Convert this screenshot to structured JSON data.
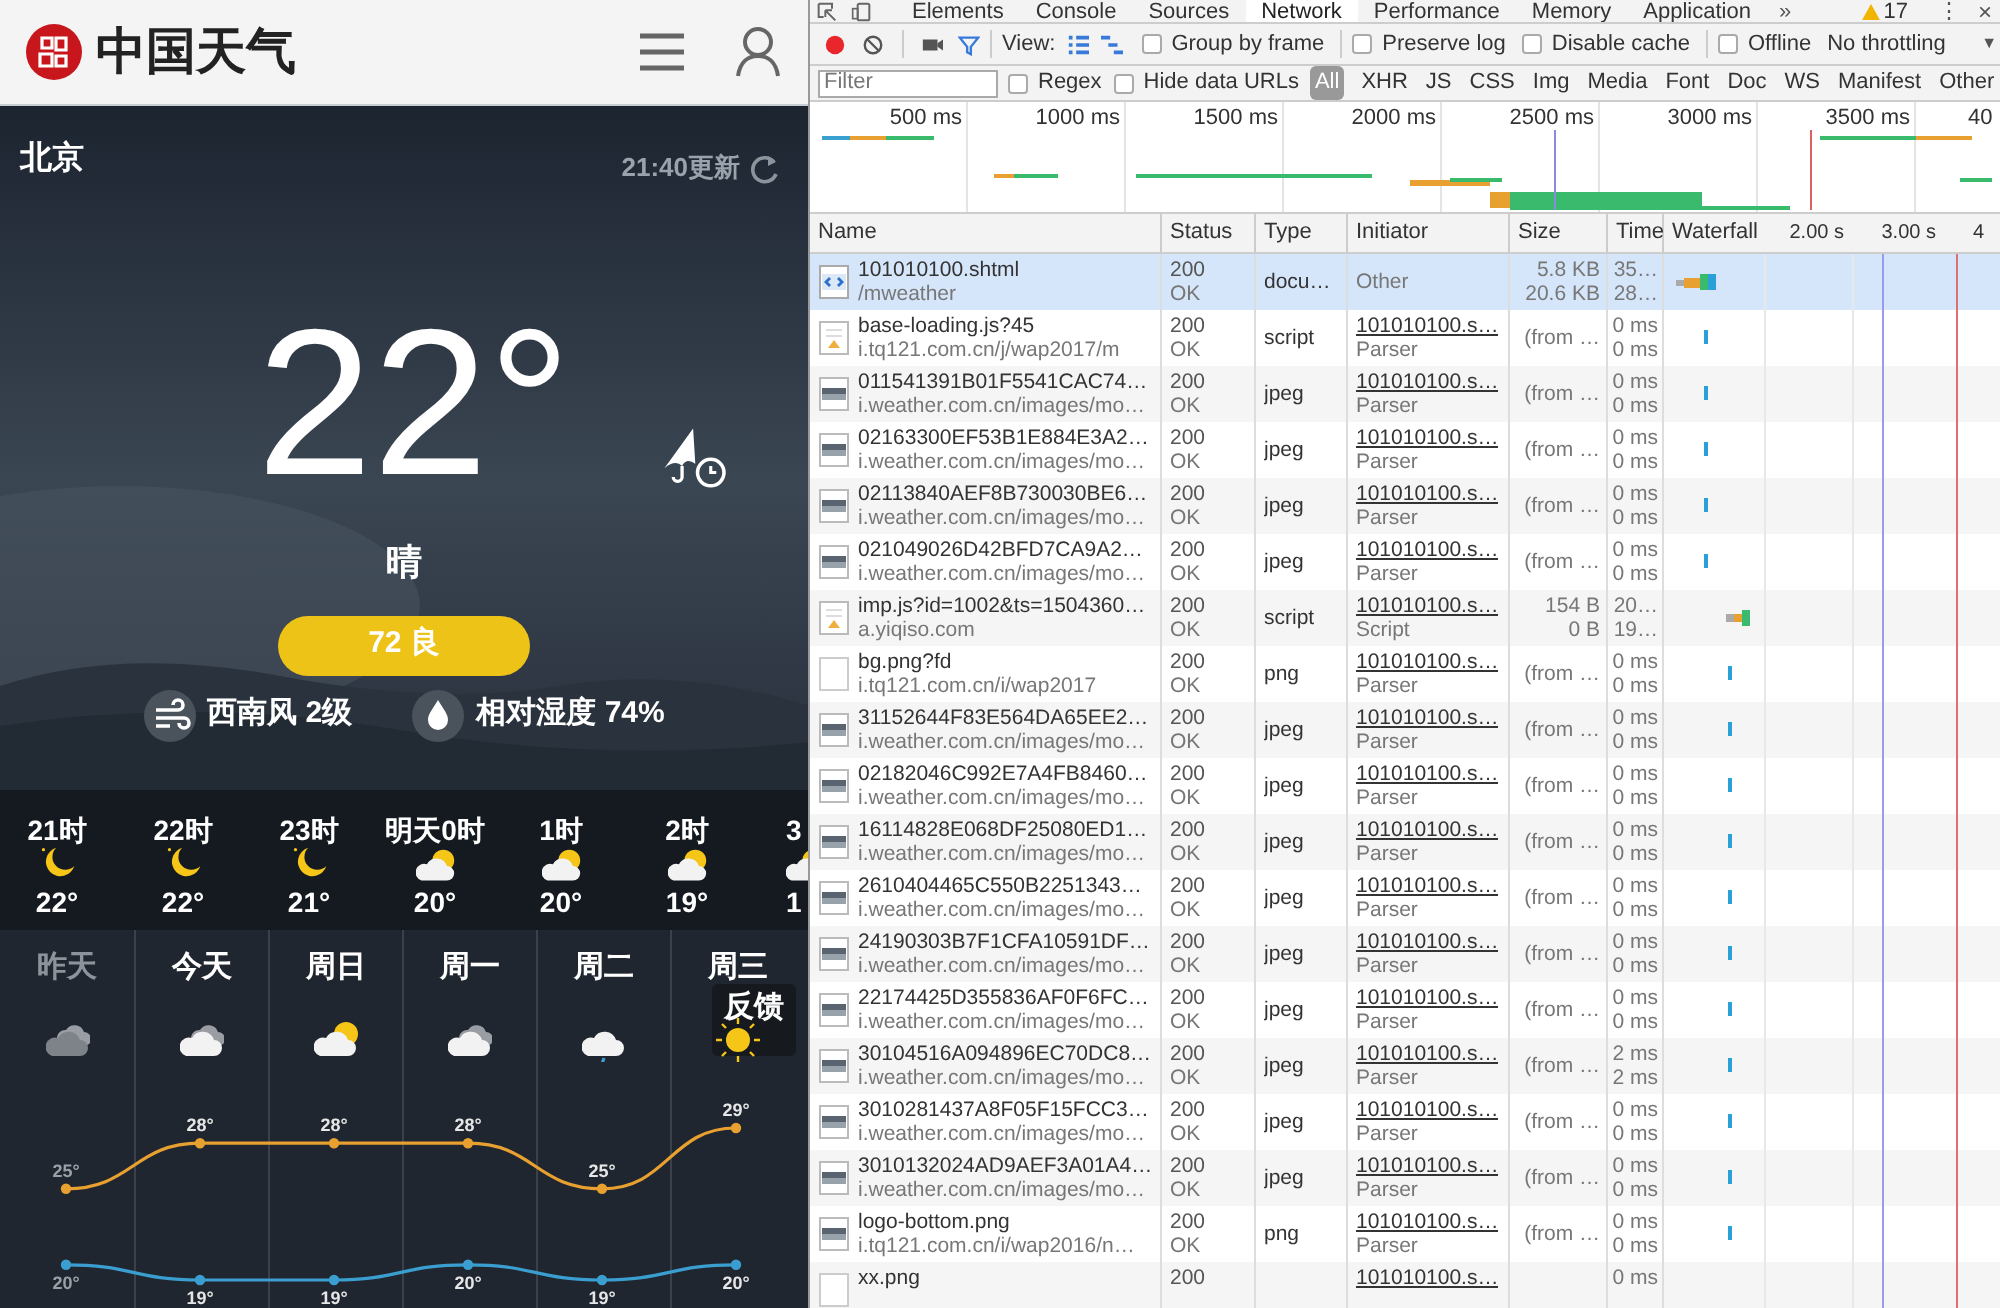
{
  "site": {
    "title": "中国天气"
  },
  "current": {
    "city": "北京",
    "updated": "21:40更新",
    "temperature": "22°",
    "condition": "晴",
    "aqi": "72 良",
    "wind": "西南风 2级",
    "humidity": "相对湿度 74%"
  },
  "hourly": [
    {
      "time": "21时",
      "kind": "moon",
      "temp": "22°"
    },
    {
      "time": "22时",
      "kind": "moon",
      "temp": "22°"
    },
    {
      "time": "23时",
      "kind": "moon",
      "temp": "21°"
    },
    {
      "time": "明天0时",
      "kind": "cloud-moon",
      "temp": "20°"
    },
    {
      "time": "1时",
      "kind": "cloud-moon",
      "temp": "20°"
    },
    {
      "time": "2时",
      "kind": "cloud-moon",
      "temp": "19°"
    },
    {
      "time": "3",
      "kind": "cloud-moon",
      "temp": "1"
    }
  ],
  "daily": {
    "days": [
      {
        "label": "昨天",
        "past": true,
        "kind": "cloud"
      },
      {
        "label": "今天",
        "past": false,
        "kind": "cloud"
      },
      {
        "label": "周日",
        "past": false,
        "kind": "partly-sunny"
      },
      {
        "label": "周一",
        "past": false,
        "kind": "cloud"
      },
      {
        "label": "周二",
        "past": false,
        "kind": "rain"
      },
      {
        "label": "周三",
        "past": false,
        "kind": "sun"
      }
    ],
    "chart_data": {
      "type": "line",
      "series": [
        {
          "color": "#e8a030",
          "marker": true,
          "values": [
            25,
            28,
            28,
            28,
            25,
            29
          ],
          "value_labels": [
            "25°",
            "28°",
            "28°",
            "28°",
            "25°",
            "29°"
          ]
        },
        {
          "color": "#3a9fd0",
          "marker": true,
          "values": [
            20,
            19,
            19,
            20,
            19,
            20
          ],
          "value_labels": [
            "20°",
            "19°",
            "19°",
            "20°",
            "19°",
            "20°"
          ]
        }
      ]
    },
    "feedback": "反馈"
  },
  "devtools": {
    "tabs": [
      {
        "label": "Elements",
        "selected": false
      },
      {
        "label": "Console",
        "selected": false
      },
      {
        "label": "Sources",
        "selected": false
      },
      {
        "label": "Network",
        "selected": true
      },
      {
        "label": "Performance",
        "selected": false
      },
      {
        "label": "Memory",
        "selected": false
      },
      {
        "label": "Application",
        "selected": false
      }
    ],
    "more": "»",
    "warnings": "17",
    "menu": "⋮",
    "close": "×",
    "toolbar": {
      "recording": true,
      "view_label": "View:",
      "checkboxes": [
        {
          "label": "Group by frame",
          "checked": false
        },
        {
          "label": "Preserve log",
          "checked": false
        },
        {
          "label": "Disable cache",
          "checked": false
        },
        {
          "label": "Offline",
          "checked": false
        }
      ],
      "throttling": "No throttling",
      "dropdown": "▼"
    },
    "filter": {
      "placeholder": "Filter",
      "checkboxes": [
        {
          "label": "Regex",
          "checked": false
        },
        {
          "label": "Hide data URLs",
          "checked": false
        }
      ],
      "types": [
        {
          "label": "All",
          "selected": true
        },
        {
          "label": "XHR",
          "selected": false
        },
        {
          "label": "JS",
          "selected": false
        },
        {
          "label": "CSS",
          "selected": false
        },
        {
          "label": "Img",
          "selected": false
        },
        {
          "label": "Media",
          "selected": false
        },
        {
          "label": "Font",
          "selected": false
        },
        {
          "label": "Doc",
          "selected": false
        },
        {
          "label": "WS",
          "selected": false
        },
        {
          "label": "Manifest",
          "selected": false
        },
        {
          "label": "Other",
          "selected": false
        }
      ]
    },
    "overview_ticks": [
      "500 ms",
      "1000 ms",
      "1500 ms",
      "2000 ms",
      "2500 ms",
      "3000 ms",
      "3500 ms",
      "40"
    ],
    "table": {
      "columns": [
        "Name",
        "Status",
        "Type",
        "Initiator",
        "Size",
        "Time",
        "Waterfall"
      ],
      "waterfall_ticks": [
        "2.00 s",
        "3.00 s",
        "4"
      ],
      "rows": [
        {
          "kind": "doc",
          "selected": true,
          "name": "101010100.shtml",
          "url": "/mweather",
          "status": "200",
          "status_text": "OK",
          "type": "docu…",
          "initiator": "Other",
          "initiator_link": false,
          "size": "5.8 KB",
          "size_2": "20.6 KB",
          "time": "35…",
          "time_2": "28…",
          "waterfall": {
            "kind": "doc-bar"
          }
        },
        {
          "kind": "script",
          "selected": false,
          "name": "base-loading.js?45",
          "url": "i.tq121.com.cn/j/wap2017/m",
          "status": "200",
          "status_text": "OK",
          "type": "script",
          "initiator": "101010100.s…",
          "initiator_2": "Parser",
          "initiator_link": true,
          "size": "(from …",
          "time": "0 ms",
          "time_2": "0 ms",
          "waterfall": {
            "kind": "tick-early"
          }
        },
        {
          "selected": false,
          "name": "011541391B01F5541CAC74…",
          "url": "i.weather.com.cn/images/mo…",
          "status": "200",
          "status_text": "OK",
          "type": "jpeg",
          "initiator": "101010100.s…",
          "initiator_2": "Parser",
          "initiator_link": true,
          "size": "(from …",
          "time": "0 ms",
          "time_2": "0 ms",
          "waterfall": {
            "kind": "tick-early"
          }
        },
        {
          "selected": false,
          "name": "02163300EF53B1E884E3A2…",
          "url": "i.weather.com.cn/images/mo…",
          "status": "200",
          "status_text": "OK",
          "type": "jpeg",
          "initiator": "101010100.s…",
          "initiator_2": "Parser",
          "initiator_link": true,
          "size": "(from …",
          "time": "0 ms",
          "time_2": "0 ms",
          "waterfall": {
            "kind": "tick-early"
          }
        },
        {
          "selected": false,
          "name": "02113840AEF8B730030BE6…",
          "url": "i.weather.com.cn/images/mo…",
          "status": "200",
          "status_text": "OK",
          "type": "jpeg",
          "initiator": "101010100.s…",
          "initiator_2": "Parser",
          "initiator_link": true,
          "size": "(from …",
          "time": "0 ms",
          "time_2": "0 ms",
          "waterfall": {
            "kind": "tick-early"
          }
        },
        {
          "selected": false,
          "name": "021049026D42BFD7CA9A2…",
          "url": "i.weather.com.cn/images/mo…",
          "status": "200",
          "status_text": "OK",
          "type": "jpeg",
          "initiator": "101010100.s…",
          "initiator_2": "Parser",
          "initiator_link": true,
          "size": "(from …",
          "time": "0 ms",
          "time_2": "0 ms",
          "waterfall": {
            "kind": "tick-early"
          }
        },
        {
          "kind": "script",
          "selected": false,
          "name": "imp.js?id=1002&ts=1504360…",
          "url": "a.yiqiso.com",
          "status": "200",
          "status_text": "OK",
          "type": "script",
          "initiator": "101010100.s…",
          "initiator_2": "Script",
          "initiator_link": true,
          "size": "154 B",
          "size_2": "0 B",
          "time": "20…",
          "time_2": "19…",
          "waterfall": {
            "kind": "script-bar"
          }
        },
        {
          "kind": "blank",
          "selected": false,
          "name": "bg.png?fd",
          "url": "i.tq121.com.cn/i/wap2017",
          "status": "200",
          "status_text": "OK",
          "type": "png",
          "initiator": "101010100.s…",
          "initiator_2": "Parser",
          "initiator_link": true,
          "size": "(from …",
          "time": "0 ms",
          "time_2": "0 ms",
          "waterfall": {
            "kind": "tick-late"
          }
        },
        {
          "selected": false,
          "name": "31152644F83E564DA65EE2…",
          "url": "i.weather.com.cn/images/mo…",
          "status": "200",
          "status_text": "OK",
          "type": "jpeg",
          "initiator": "101010100.s…",
          "initiator_2": "Parser",
          "initiator_link": true,
          "size": "(from …",
          "time": "0 ms",
          "time_2": "0 ms",
          "waterfall": {
            "kind": "tick-late"
          }
        },
        {
          "selected": false,
          "name": "02182046C992E7A4FB8460…",
          "url": "i.weather.com.cn/images/mo…",
          "status": "200",
          "status_text": "OK",
          "type": "jpeg",
          "initiator": "101010100.s…",
          "initiator_2": "Parser",
          "initiator_link": true,
          "size": "(from …",
          "time": "0 ms",
          "time_2": "0 ms",
          "waterfall": {
            "kind": "tick-late"
          }
        },
        {
          "selected": false,
          "name": "16114828E068DF25080ED1…",
          "url": "i.weather.com.cn/images/mo…",
          "status": "200",
          "status_text": "OK",
          "type": "jpeg",
          "initiator": "101010100.s…",
          "initiator_2": "Parser",
          "initiator_link": true,
          "size": "(from …",
          "time": "0 ms",
          "time_2": "0 ms",
          "waterfall": {
            "kind": "tick-late"
          }
        },
        {
          "selected": false,
          "name": "2610404465C550B2251343…",
          "url": "i.weather.com.cn/images/mo…",
          "status": "200",
          "status_text": "OK",
          "type": "jpeg",
          "initiator": "101010100.s…",
          "initiator_2": "Parser",
          "initiator_link": true,
          "size": "(from …",
          "time": "0 ms",
          "time_2": "0 ms",
          "waterfall": {
            "kind": "tick-late"
          }
        },
        {
          "selected": false,
          "name": "24190303B7F1CFA10591DF…",
          "url": "i.weather.com.cn/images/mo…",
          "status": "200",
          "status_text": "OK",
          "type": "jpeg",
          "initiator": "101010100.s…",
          "initiator_2": "Parser",
          "initiator_link": true,
          "size": "(from …",
          "time": "0 ms",
          "time_2": "0 ms",
          "waterfall": {
            "kind": "tick-late"
          }
        },
        {
          "selected": false,
          "name": "22174425D355836AF0F6FC…",
          "url": "i.weather.com.cn/images/mo…",
          "status": "200",
          "status_text": "OK",
          "type": "jpeg",
          "initiator": "101010100.s…",
          "initiator_2": "Parser",
          "initiator_link": true,
          "size": "(from …",
          "time": "0 ms",
          "time_2": "0 ms",
          "waterfall": {
            "kind": "tick-late"
          }
        },
        {
          "selected": false,
          "name": "30104516A094896EC70DC8…",
          "url": "i.weather.com.cn/images/mo…",
          "status": "200",
          "status_text": "OK",
          "type": "jpeg",
          "initiator": "101010100.s…",
          "initiator_2": "Parser",
          "initiator_link": true,
          "size": "(from …",
          "time": "2 ms",
          "time_2": "2 ms",
          "waterfall": {
            "kind": "tick-late"
          }
        },
        {
          "selected": false,
          "name": "3010281437A8F05F15FCC3…",
          "url": "i.weather.com.cn/images/mo…",
          "status": "200",
          "status_text": "OK",
          "type": "jpeg",
          "initiator": "101010100.s…",
          "initiator_2": "Parser",
          "initiator_link": true,
          "size": "(from …",
          "time": "0 ms",
          "time_2": "0 ms",
          "waterfall": {
            "kind": "tick-late"
          }
        },
        {
          "selected": false,
          "name": "3010132024AD9AEF3A01A4…",
          "url": "i.weather.com.cn/images/mo…",
          "status": "200",
          "status_text": "OK",
          "type": "jpeg",
          "initiator": "101010100.s…",
          "initiator_2": "Parser",
          "initiator_link": true,
          "size": "(from …",
          "time": "0 ms",
          "time_2": "0 ms",
          "waterfall": {
            "kind": "tick-late"
          }
        },
        {
          "selected": false,
          "name": "logo-bottom.png",
          "url": "i.tq121.com.cn/i/wap2016/n…",
          "status": "200",
          "status_text": "OK",
          "type": "png",
          "initiator": "101010100.s…",
          "initiator_2": "Parser",
          "initiator_link": true,
          "size": "(from …",
          "time": "0 ms",
          "time_2": "0 ms",
          "waterfall": {
            "kind": "tick-late"
          }
        },
        {
          "kind": "blank",
          "selected": false,
          "name": "xx.png",
          "status": "200",
          "initiator": "101010100.s…",
          "initiator_link": true,
          "time": "0 ms"
        }
      ]
    }
  }
}
